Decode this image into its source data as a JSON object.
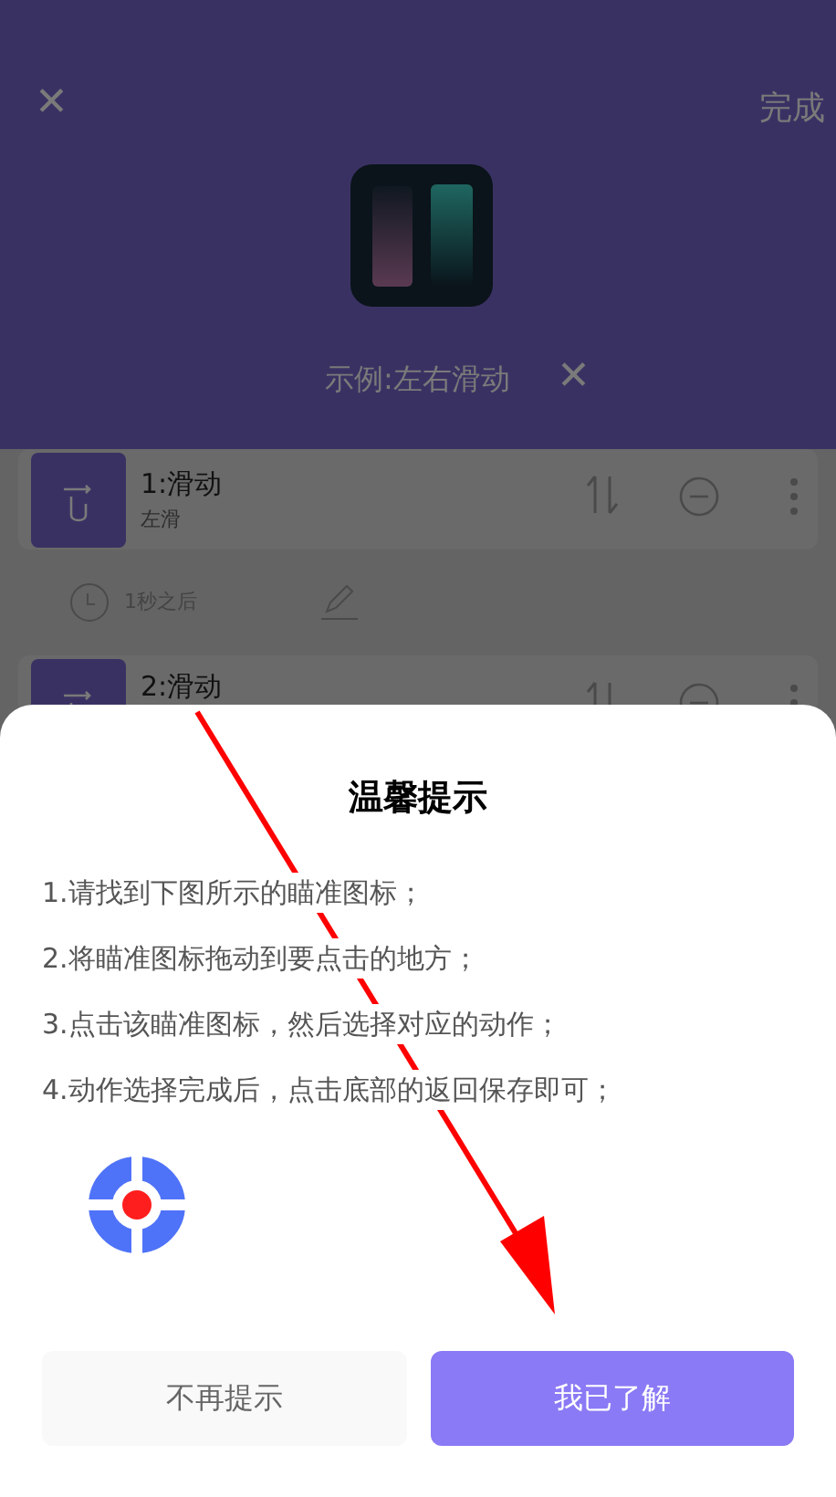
{
  "header": {
    "close": "✕",
    "done": "完成",
    "example_label": "示例:左右滑动"
  },
  "actions": [
    {
      "title": "1:滑动",
      "subtitle": "左滑",
      "delay": "1秒之后"
    },
    {
      "title": "2:滑动"
    }
  ],
  "dialog": {
    "title": "温馨提示",
    "steps": [
      "1.请找到下图所示的瞄准图标；",
      "2.将瞄准图标拖动到要点击的地方；",
      "3.点击该瞄准图标，然后选择对应的动作；",
      "4.动作选择完成后，点击底部的返回保存即可；"
    ],
    "buttons": [
      {
        "kind": "secondary",
        "label": "不再提示"
      },
      {
        "kind": "primary",
        "label": "我已了解"
      }
    ]
  }
}
